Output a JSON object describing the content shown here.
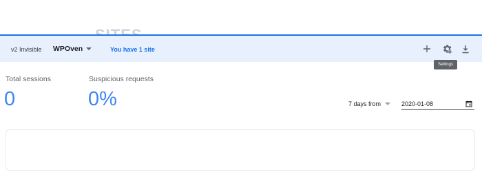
{
  "page": {
    "cut_heading": "SITES"
  },
  "header": {
    "key_type": "v2 Invisible",
    "site_name": "WPOven",
    "site_count": "You have 1 site",
    "icons": {
      "add": "plus-icon",
      "settings": "gear-icon",
      "download": "download-icon"
    },
    "settings_tooltip": "Settings",
    "accent_color": "#1a73e8",
    "background_color": "#e8f0fe"
  },
  "stats": {
    "total_sessions": {
      "label": "Total sessions",
      "value": "0"
    },
    "suspicious_requests": {
      "label": "Suspicious requests",
      "value": "0%"
    },
    "value_color": "#4285f4"
  },
  "filters": {
    "range_label": "7 days from",
    "date_value": "2020-01-08",
    "date_icon": "calendar-icon"
  }
}
